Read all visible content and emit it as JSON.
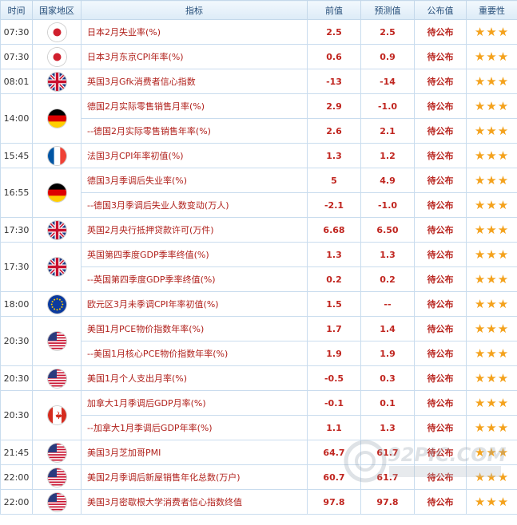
{
  "header": {
    "time": "时间",
    "region": "国家地区",
    "indicator": "指标",
    "previous": "前值",
    "forecast": "预测值",
    "published": "公布值",
    "importance": "重要性"
  },
  "groups": [
    {
      "time": "07:30",
      "flag": "japan-flag-icon",
      "rows": [
        {
          "name": "日本2月失业率(%)",
          "prev": "2.5",
          "fcst": "2.5",
          "pub": "待公布",
          "stars": "★★★"
        }
      ]
    },
    {
      "time": "07:30",
      "flag": "japan-flag-icon",
      "rows": [
        {
          "name": "日本3月东京CPI年率(%)",
          "prev": "0.6",
          "fcst": "0.9",
          "pub": "待公布",
          "stars": "★★★"
        }
      ]
    },
    {
      "time": "08:01",
      "flag": "uk-flag-icon",
      "rows": [
        {
          "name": "英国3月Gfk消费者信心指数",
          "prev": "-13",
          "fcst": "-14",
          "pub": "待公布",
          "stars": "★★★"
        }
      ]
    },
    {
      "time": "14:00",
      "flag": "germany-flag-icon",
      "rows": [
        {
          "name": "德国2月实际零售销售月率(%)",
          "prev": "2.9",
          "fcst": "-1.0",
          "pub": "待公布",
          "stars": "★★★"
        },
        {
          "name": "--德国2月实际零售销售年率(%)",
          "prev": "2.6",
          "fcst": "2.1",
          "pub": "待公布",
          "stars": "★★★"
        }
      ]
    },
    {
      "time": "15:45",
      "flag": "france-flag-icon",
      "rows": [
        {
          "name": "法国3月CPI年率初值(%)",
          "prev": "1.3",
          "fcst": "1.2",
          "pub": "待公布",
          "stars": "★★★"
        }
      ]
    },
    {
      "time": "16:55",
      "flag": "germany-flag-icon",
      "rows": [
        {
          "name": "德国3月季调后失业率(%)",
          "prev": "5",
          "fcst": "4.9",
          "pub": "待公布",
          "stars": "★★★"
        },
        {
          "name": "--德国3月季调后失业人数变动(万人)",
          "prev": "-2.1",
          "fcst": "-1.0",
          "pub": "待公布",
          "stars": "★★★"
        }
      ]
    },
    {
      "time": "17:30",
      "flag": "uk-flag-icon",
      "rows": [
        {
          "name": "英国2月央行抵押贷款许可(万件)",
          "prev": "6.68",
          "fcst": "6.50",
          "pub": "待公布",
          "stars": "★★★"
        }
      ]
    },
    {
      "time": "17:30",
      "flag": "uk-flag-icon",
      "rows": [
        {
          "name": "英国第四季度GDP季率终值(%)",
          "prev": "1.3",
          "fcst": "1.3",
          "pub": "待公布",
          "stars": "★★★"
        },
        {
          "name": "--英国第四季度GDP季率终值(%)",
          "prev": "0.2",
          "fcst": "0.2",
          "pub": "待公布",
          "stars": "★★★"
        }
      ]
    },
    {
      "time": "18:00",
      "flag": "eu-flag-icon",
      "rows": [
        {
          "name": "欧元区3月未季调CPI年率初值(%)",
          "prev": "1.5",
          "fcst": "--",
          "pub": "待公布",
          "stars": "★★★"
        }
      ]
    },
    {
      "time": "20:30",
      "flag": "usa-flag-icon",
      "rows": [
        {
          "name": "美国1月PCE物价指数年率(%)",
          "prev": "1.7",
          "fcst": "1.4",
          "pub": "待公布",
          "stars": "★★★"
        },
        {
          "name": "--美国1月核心PCE物价指数年率(%)",
          "prev": "1.9",
          "fcst": "1.9",
          "pub": "待公布",
          "stars": "★★★"
        }
      ]
    },
    {
      "time": "20:30",
      "flag": "usa-flag-icon",
      "rows": [
        {
          "name": "美国1月个人支出月率(%)",
          "prev": "-0.5",
          "fcst": "0.3",
          "pub": "待公布",
          "stars": "★★★"
        }
      ]
    },
    {
      "time": "20:30",
      "flag": "canada-flag-icon",
      "rows": [
        {
          "name": "加拿大1月季调后GDP月率(%)",
          "prev": "-0.1",
          "fcst": "0.1",
          "pub": "待公布",
          "stars": "★★★"
        },
        {
          "name": "--加拿大1月季调后GDP年率(%)",
          "prev": "1.1",
          "fcst": "1.3",
          "pub": "待公布",
          "stars": "★★★"
        }
      ]
    },
    {
      "time": "21:45",
      "flag": "usa-flag-icon",
      "rows": [
        {
          "name": "美国3月芝加哥PMI",
          "prev": "64.7",
          "fcst": "61.7",
          "pub": "待公布",
          "stars": "★★★"
        }
      ]
    },
    {
      "time": "22:00",
      "flag": "usa-flag-icon",
      "rows": [
        {
          "name": "美国2月季调后新屋销售年化总数(万户)",
          "prev": "60.7",
          "fcst": "61.7",
          "pub": "待公布",
          "stars": "★★★"
        }
      ]
    },
    {
      "time": "22:00",
      "flag": "usa-flag-icon",
      "rows": [
        {
          "name": "美国3月密歇根大学消费者信心指数终值",
          "prev": "97.8",
          "fcst": "97.8",
          "pub": "待公布",
          "stars": "★★★"
        }
      ]
    }
  ],
  "watermark": "92PIC.COM",
  "colors": {
    "header_text": "#274f7a",
    "indicator_text": "#b1211c",
    "value_text": "#c0251f",
    "star": "#f4a21d",
    "border": "#c9dcee"
  }
}
